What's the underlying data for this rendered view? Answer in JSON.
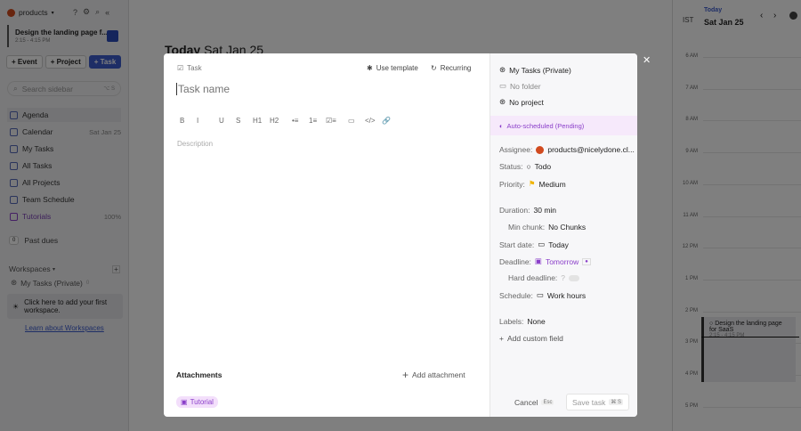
{
  "sidebar": {
    "workspace": "products",
    "current_event": {
      "title": "Design the landing page f...",
      "time": "2:15 - 4:15 PM"
    },
    "buttons": {
      "event": "Event",
      "project": "Project",
      "task": "Task"
    },
    "search_placeholder": "Search sidebar",
    "search_shortcut": "⌥ S",
    "nav": [
      {
        "label": "Agenda"
      },
      {
        "label": "Calendar",
        "right": "Sat Jan 25"
      },
      {
        "label": "My Tasks"
      },
      {
        "label": "All Tasks"
      },
      {
        "label": "All Projects"
      },
      {
        "label": "Team Schedule"
      },
      {
        "label": "Tutorials",
        "right": "100%"
      }
    ],
    "past_dues_count": "0",
    "past_dues": "Past dues",
    "workspaces": "Workspaces",
    "my_tasks_private": "My Tasks (Private)",
    "my_tasks_count": "0",
    "add_workspace": "Click here to add your first workspace.",
    "learn": "Learn about Workspaces"
  },
  "main": {
    "today": "Today",
    "date": "Sat Jan 25"
  },
  "calendar": {
    "tz": "IST",
    "today": "Today",
    "date": "Sat Jan 25",
    "hours": [
      "6 AM",
      "7 AM",
      "8 AM",
      "9 AM",
      "10 AM",
      "11 AM",
      "12 PM",
      "1 PM",
      "2 PM",
      "3 PM",
      "4 PM",
      "5 PM"
    ],
    "event": {
      "title": "Design the landing page for SaaS",
      "time": "2:15 - 4:15 PM"
    }
  },
  "modal": {
    "type": "Task",
    "use_template": "Use template",
    "recurring": "Recurring",
    "name_placeholder": "Task name",
    "description_placeholder": "Description",
    "toolbar": [
      "B",
      "I",
      "U",
      "S",
      "H1",
      "H2",
      "•≡",
      "1≡",
      "☑≡",
      "▭",
      "</>",
      "🔗"
    ],
    "attachments": "Attachments",
    "add_attachment": "Add attachment",
    "tutorial": "Tutorial",
    "cancel": "Cancel",
    "cancel_key": "Esc",
    "save": "Save task",
    "save_key": "⌘ S",
    "right": {
      "workspace": "My Tasks (Private)",
      "folder": "No folder",
      "project": "No project",
      "auto": "Auto-scheduled (Pending)",
      "assignee_label": "Assignee:",
      "assignee": "products@nicelydone.cl...",
      "status_label": "Status:",
      "status": "Todo",
      "priority_label": "Priority:",
      "priority": "Medium",
      "duration_label": "Duration:",
      "duration": "30 min",
      "min_chunk_label": "Min chunk:",
      "min_chunk": "No Chunks",
      "start_label": "Start date:",
      "start": "Today",
      "deadline_label": "Deadline:",
      "deadline": "Tomorrow",
      "hard_label": "Hard deadline:",
      "schedule_label": "Schedule:",
      "schedule": "Work hours",
      "labels_label": "Labels:",
      "labels": "None",
      "add_field": "Add custom field"
    }
  },
  "colors": {
    "accent": "#3d5ccc",
    "purple": "#8a3ec9",
    "auto_bg": "#f6e9fb",
    "priority": "#f0b400",
    "avatar": "#d14a1f"
  }
}
